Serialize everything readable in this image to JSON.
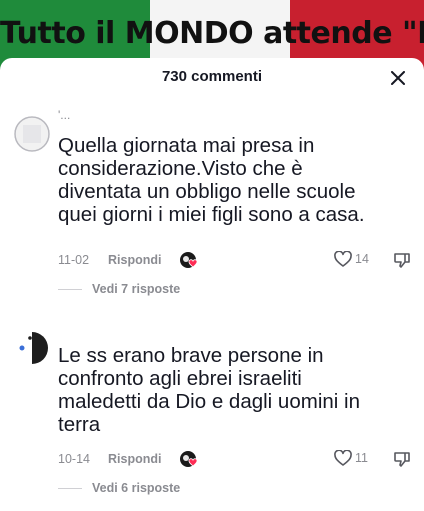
{
  "video": {
    "overlay_text": "Tutto il MONDO attende \"IL",
    "colors": {
      "green": "#1f8b3b",
      "white": "#f4f4f4",
      "red": "#c8202f"
    }
  },
  "comments_panel": {
    "title": "730 commenti",
    "close_icon": "close-icon"
  },
  "comments": [
    {
      "username": "'...",
      "text": "Quella giornata mai presa in considerazione.Visto che è diventata un obbligo nelle scuole quei giorni i miei figli sono a casa.",
      "date": "11-02",
      "reply_label": "Rispondi",
      "likes": "14",
      "view_replies": "Vedi 7 risposte"
    },
    {
      "username": "",
      "text": "Le ss erano brave persone in confronto agli ebrei israeliti maledetti da Dio e dagli uomini in terra",
      "date": "10-14",
      "reply_label": "Rispondi",
      "likes": "11",
      "view_replies": "Vedi 6 risposte"
    }
  ]
}
